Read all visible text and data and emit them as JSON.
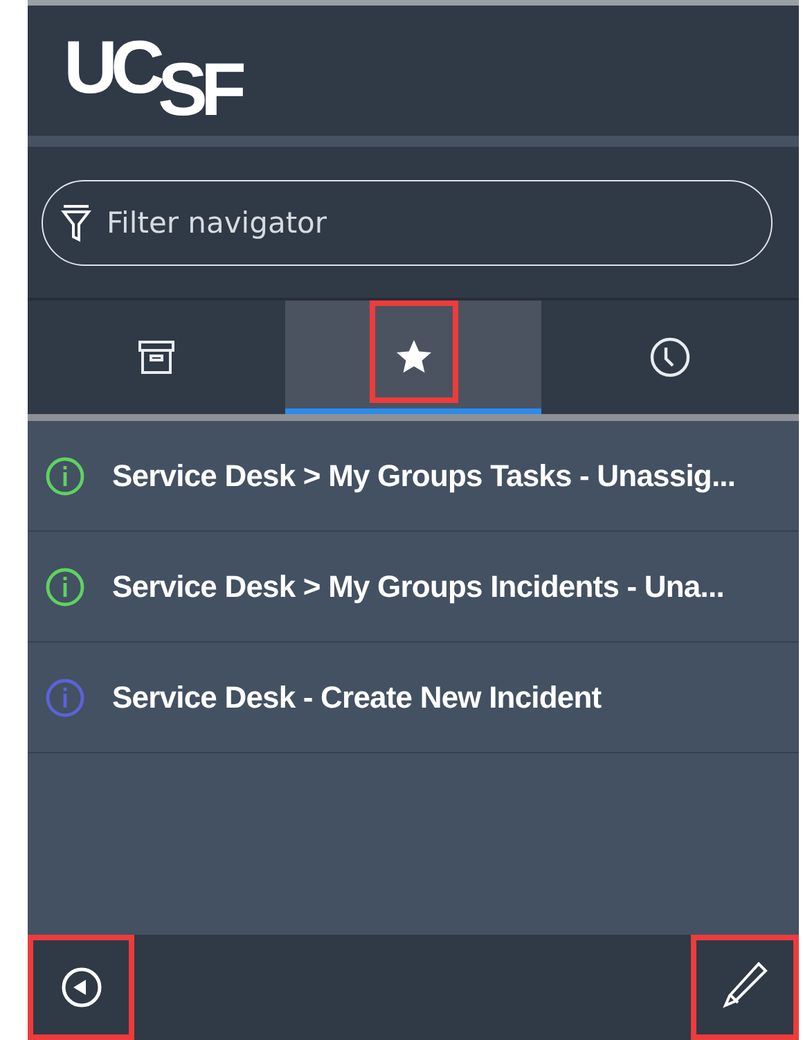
{
  "logo": "UC$_{SF}$",
  "search": {
    "placeholder": "Filter navigator"
  },
  "tabs": [
    {
      "kind": "archive",
      "selected": false,
      "highlighted": false
    },
    {
      "kind": "star",
      "selected": true,
      "highlighted": true
    },
    {
      "kind": "history",
      "selected": false,
      "highlighted": false
    }
  ],
  "items": [
    {
      "label": "Service Desk > My Groups Tasks - Unassig...",
      "color": "#5fd35f"
    },
    {
      "label": "Service Desk > My Groups Incidents - Una...",
      "color": "#5fd35f"
    },
    {
      "label": "Service Desk - Create New Incident",
      "color": "#5b63d6"
    }
  ],
  "footer": [
    {
      "kind": "collapse",
      "highlighted": true
    },
    {
      "kind": "edit",
      "highlighted": true
    }
  ]
}
